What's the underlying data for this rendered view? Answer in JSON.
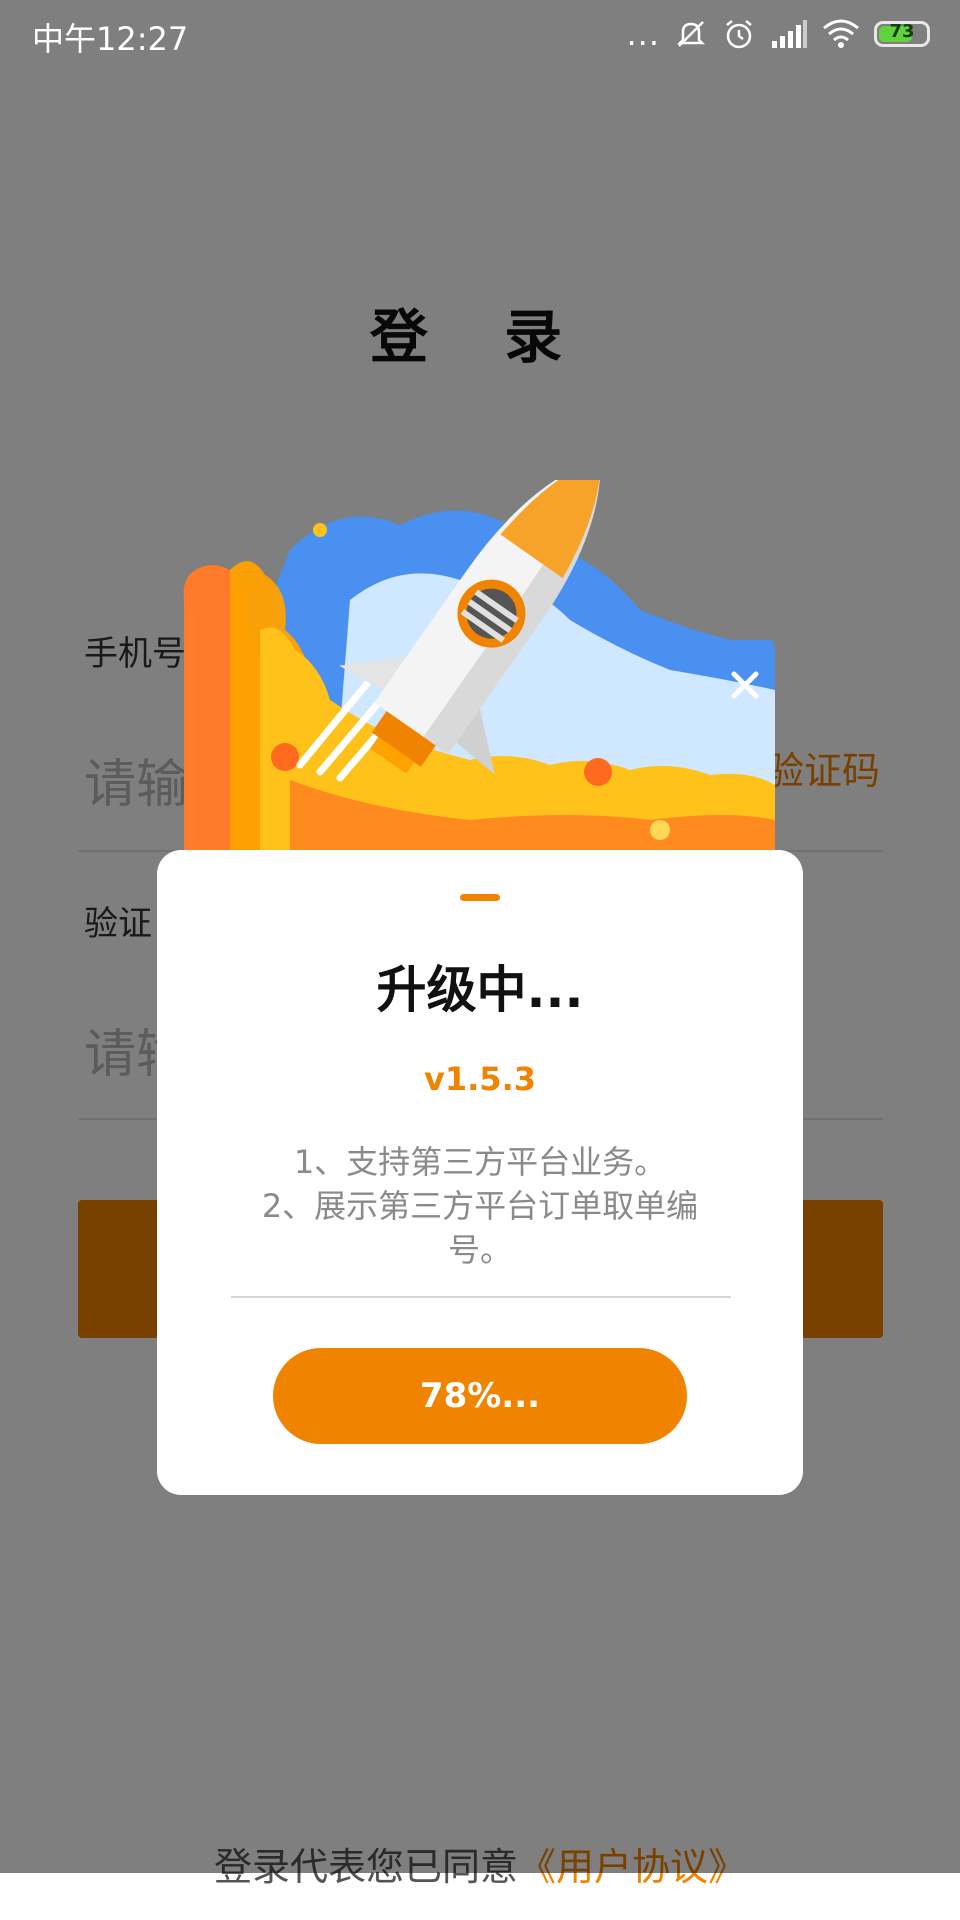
{
  "status_bar": {
    "time": "中午12:27",
    "dots": "...",
    "battery": "73",
    "battery_level": 0.73,
    "icons": [
      "mute-notifications-icon",
      "alarm-icon",
      "signal-icon",
      "wifi-icon",
      "battery-icon"
    ]
  },
  "login": {
    "title": "登 录",
    "phone_label": "手机号",
    "phone_placeholder": "请输",
    "get_code": "验证码",
    "code_label": "验证",
    "code_placeholder": "请输",
    "agreement_prefix": "登录代表您已同意",
    "agreement_link": "《用户协议》"
  },
  "dialog": {
    "title": "升级中...",
    "version": "v1.5.3",
    "notes": [
      "1、支持第三方平台业务。",
      "2、展示第三方平台订单取单编号。"
    ],
    "progress_label": "78%...",
    "progress_percent": 78,
    "close_icon": "close-icon",
    "banner_icon": "rocket-icon"
  },
  "colors": {
    "accent": "#f08300",
    "overlay": "rgba(0,0,0,0.5)",
    "banner_blue": "#4a90f0",
    "flame_orange": "#ff7a2b"
  }
}
